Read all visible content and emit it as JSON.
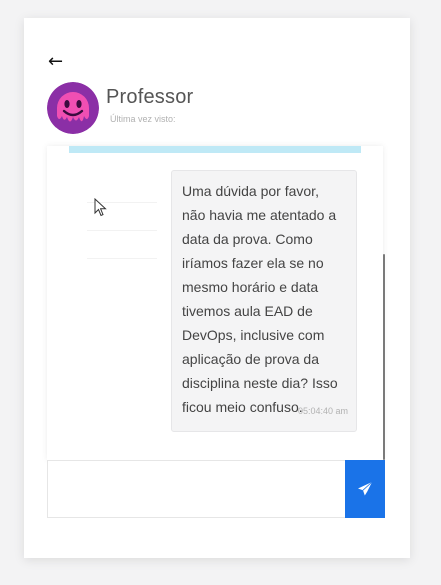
{
  "header": {
    "back_icon": "arrow-left-icon",
    "contact_name": "Professor",
    "last_seen": "Última vez visto:",
    "avatar_icon": "melting-smiley-icon"
  },
  "conversation": {
    "messages": [
      {
        "text": "Uma dúvida por favor, não havia me atentado a data da prova. Como iríamos fazer ela se no mesmo horário e data tivemos aula EAD de DevOps, inclusive com aplicação de prova da disciplina neste dia? Isso ficou meio confuso.",
        "time": "05:04:40 am"
      }
    ]
  },
  "composer": {
    "value": "",
    "placeholder": "",
    "send_icon": "paper-plane-icon"
  },
  "colors": {
    "accent": "#1a73e8",
    "strip": "#bfe9f6",
    "avatar_bg": "#8b2fa6",
    "avatar_face": "#f04fb3"
  }
}
